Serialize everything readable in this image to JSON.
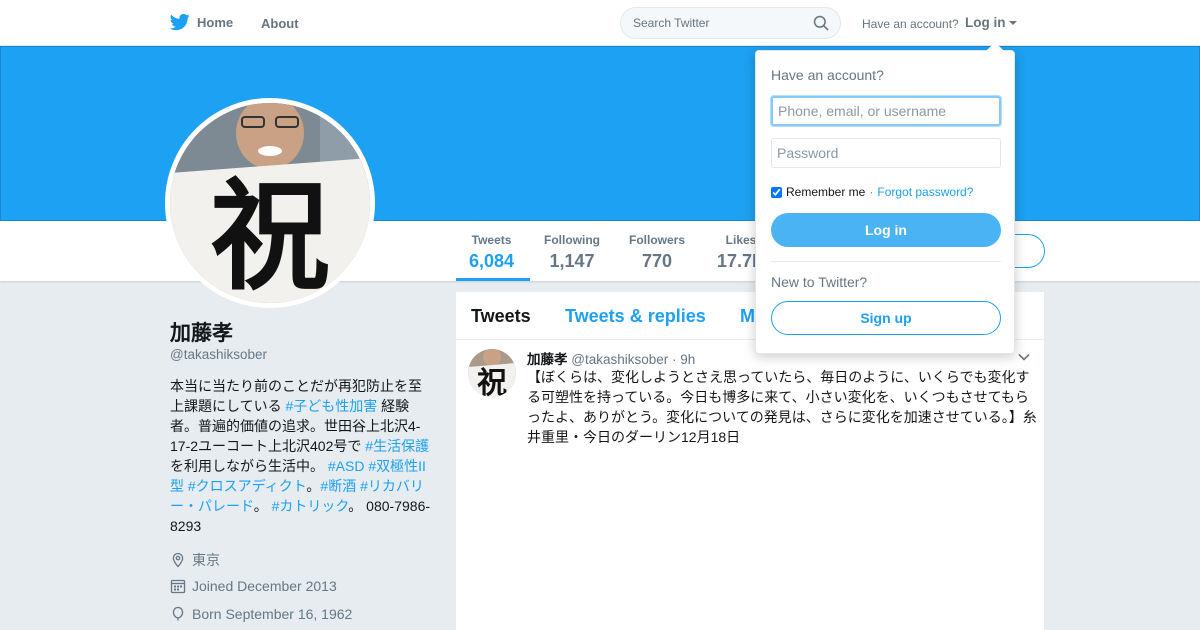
{
  "colors": {
    "brand": "#1da1f2",
    "banner": "#1da1f2",
    "login_button": "#4ab3f4",
    "text_secondary": "#657786"
  },
  "nav": {
    "home_label": "Home",
    "about_label": "About",
    "search_placeholder": "Search Twitter",
    "have_account": "Have an account?",
    "login_label": "Log in"
  },
  "icons": {
    "logo": "twitter-bird-icon",
    "search": "search-icon",
    "location": "location-pin-icon",
    "joined": "calendar-icon",
    "born": "balloon-icon",
    "tweet_menu": "chevron-down-icon"
  },
  "profile": {
    "name": "加藤孝",
    "handle": "@takashiksober",
    "bio": [
      {
        "t": "本当に当たり前のことだが再犯防止を至上課題にしている "
      },
      {
        "t": "#子ども性加害",
        "tag": true
      },
      {
        "t": " 経験者。普遍的価値の追求。世田谷上北沢4-17-2ユーコート上北沢402号で "
      },
      {
        "t": "#生活保護",
        "tag": true
      },
      {
        "t": " を利用しながら生活中。 "
      },
      {
        "t": "#ASD",
        "tag": true
      },
      {
        "t": " "
      },
      {
        "t": "#双極性II型",
        "tag": true
      },
      {
        "t": " "
      },
      {
        "t": "#クロスアディクト",
        "tag": true
      },
      {
        "t": "。"
      },
      {
        "t": "#断酒",
        "tag": true
      },
      {
        "t": " "
      },
      {
        "t": "#リカバリー・パレード",
        "tag": true
      },
      {
        "t": "。 "
      },
      {
        "t": "#カトリック",
        "tag": true
      },
      {
        "t": "。 080-7986-8293"
      }
    ],
    "location": "東京",
    "joined": "Joined December 2013",
    "born": "Born September 16, 1962"
  },
  "stats": [
    {
      "label": "Tweets",
      "value": "6,084",
      "active": true
    },
    {
      "label": "Following",
      "value": "1,147"
    },
    {
      "label": "Followers",
      "value": "770"
    },
    {
      "label": "Likes",
      "value": "17.7K"
    }
  ],
  "timeline": {
    "tabs": [
      "Tweets",
      "Tweets & replies",
      "Media"
    ],
    "tweet": {
      "name": "加藤孝",
      "handle": "@takashiksober",
      "time": "9h",
      "text": "【ぼくらは、変化しようとさえ思っていたら、毎日のように、いくらでも変化する可塑性を持っている。今日も博多に来て、小さい変化を、いくつもさせてもらったよ、ありがとう。変化についての発見は、さらに変化を加速させている。】糸井重里・今日のダーリン12月18日"
    }
  },
  "login_dropdown": {
    "title": "Have an account?",
    "username_placeholder": "Phone, email, or username",
    "password_placeholder": "Password",
    "remember_label": "Remember me",
    "separator": "·",
    "forgot_label": "Forgot password?",
    "login_button": "Log in",
    "new_to_twitter": "New to Twitter?",
    "signup_button": "Sign up"
  }
}
